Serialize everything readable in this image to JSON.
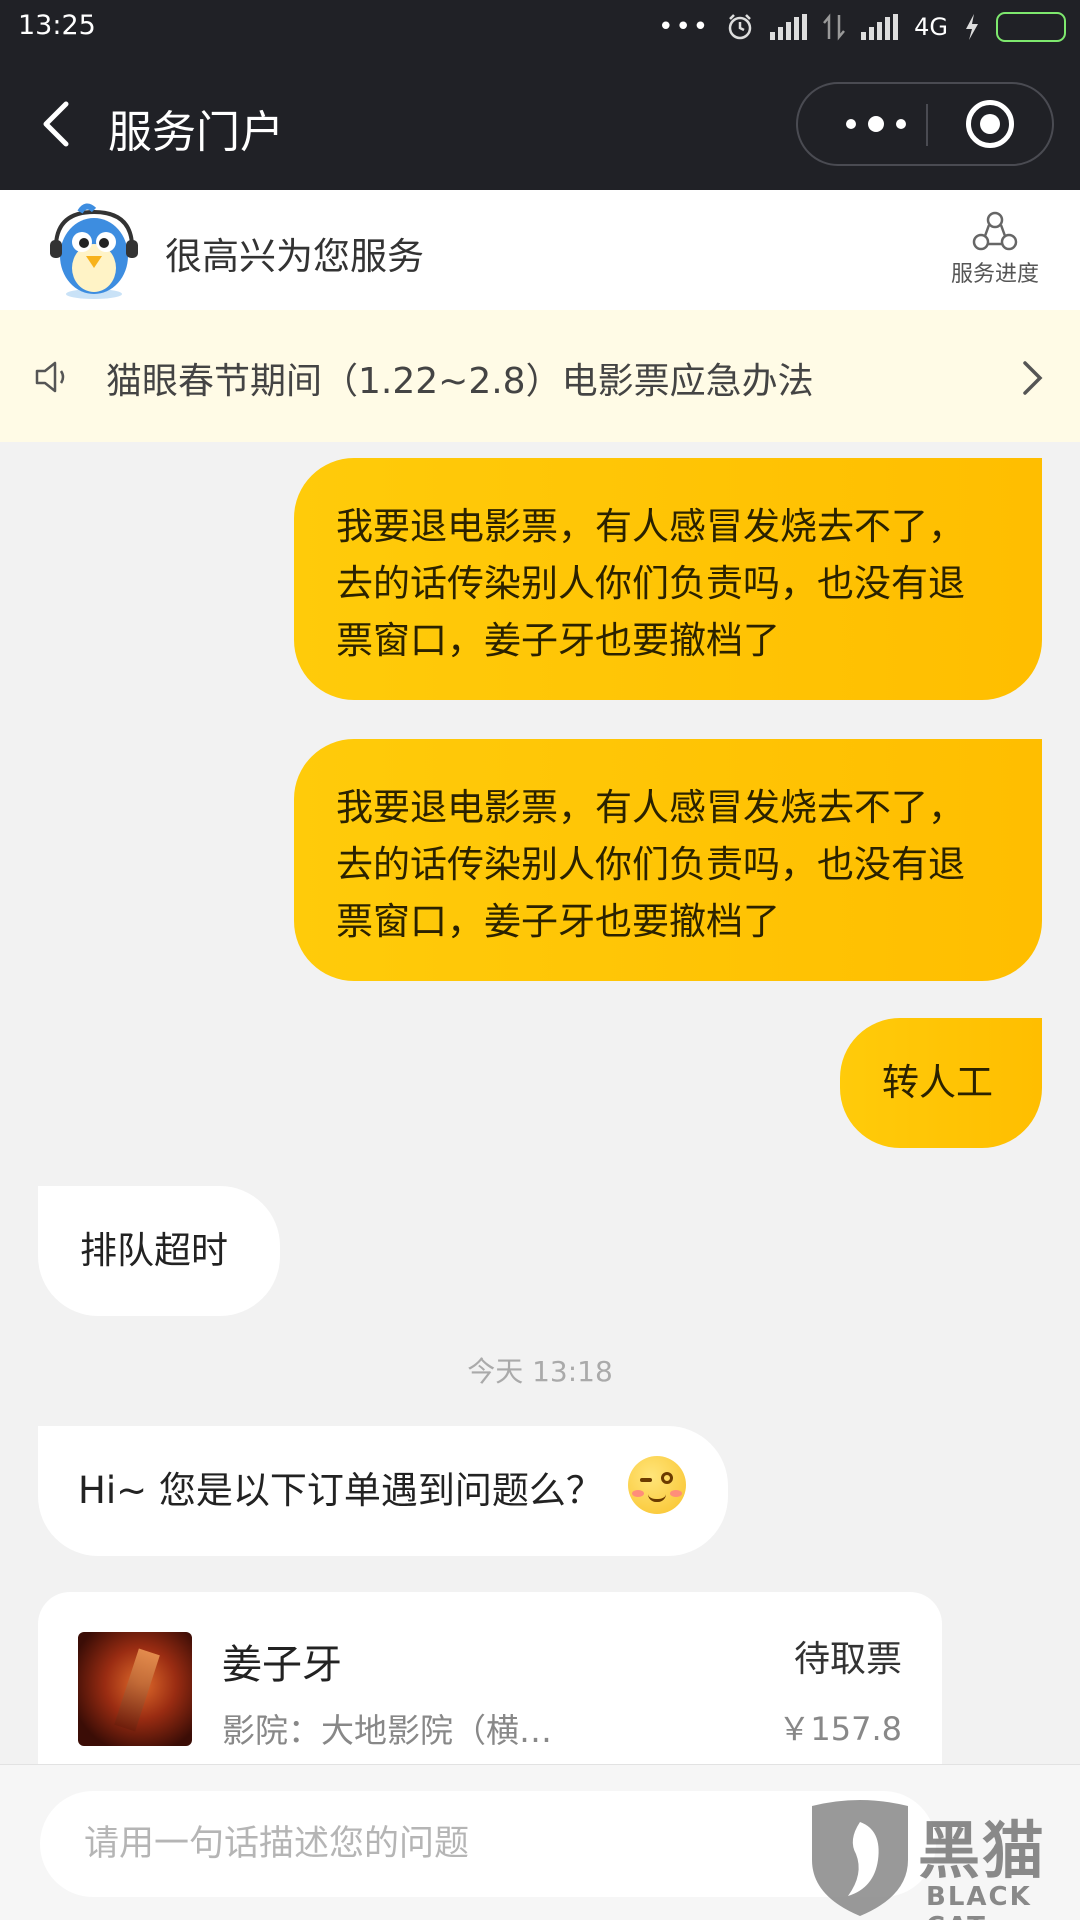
{
  "status_bar": {
    "time": "13:25",
    "network": "4G"
  },
  "title_bar": {
    "title": "服务门户"
  },
  "service_header": {
    "welcome": "很高兴为您服务",
    "progress_label": "服务进度"
  },
  "notice": {
    "text": "猫眼春节期间（1.22~2.8）电影票应急办法"
  },
  "chat": {
    "msg_refund_1": "我要退电影票，有人感冒发烧去不了，去的话传染别人你们负责吗，也没有退票窗口，姜子牙也要撤档了",
    "msg_refund_2": "我要退电影票，有人感冒发烧去不了，去的话传染别人你们负责吗，也没有退票窗口，姜子牙也要撤档了",
    "msg_human": "转人工",
    "msg_timeout": "排队超时",
    "timestamp": "今天 13:18",
    "msg_question": "Hi~ 您是以下订单遇到问题么？",
    "emoji": "wink-face"
  },
  "order": {
    "title": "姜子牙",
    "cinema": "影院：大地影院（横…",
    "status": "待取票",
    "price": "￥157.8"
  },
  "input": {
    "placeholder": "请用一句话描述您的问题"
  },
  "watermark": {
    "main": "黑猫",
    "sub": "BLACK CAT"
  },
  "colors": {
    "accent": "#ffc400",
    "bar": "#202126",
    "notice_bg": "#fffbe6"
  }
}
